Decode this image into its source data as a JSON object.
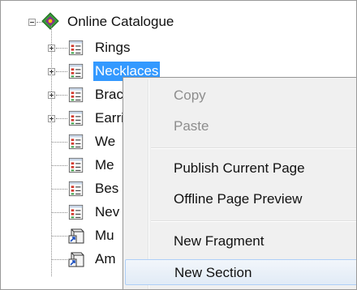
{
  "tree": {
    "root": {
      "label": "Online Catalogue",
      "icon": "catalogue-icon"
    },
    "items": [
      {
        "label": "Rings",
        "icon": "page-icon",
        "expandable": true
      },
      {
        "label": "Necklaces",
        "icon": "page-icon",
        "expandable": true,
        "selected": true
      },
      {
        "label": "Bracelets",
        "icon": "page-icon",
        "expandable": true
      },
      {
        "label": "Earrings",
        "icon": "page-icon",
        "expandable": true
      },
      {
        "label": "We",
        "icon": "page-icon",
        "expandable": false
      },
      {
        "label": "Me",
        "icon": "page-icon",
        "expandable": false
      },
      {
        "label": "Bes",
        "icon": "page-icon",
        "expandable": false
      },
      {
        "label": "Nev",
        "icon": "page-icon",
        "expandable": false
      },
      {
        "label": "Mu",
        "icon": "section-icon",
        "expandable": false
      },
      {
        "label": "Am",
        "icon": "section-icon",
        "expandable": false
      }
    ]
  },
  "context_menu": {
    "items": [
      {
        "label": "Copy",
        "enabled": false
      },
      {
        "label": "Paste",
        "enabled": false
      },
      {
        "label": "Publish Current Page",
        "enabled": true
      },
      {
        "label": "Offline Page Preview",
        "enabled": true
      },
      {
        "label": "New Fragment",
        "enabled": true
      },
      {
        "label": "New Section",
        "enabled": true,
        "hovered": true
      }
    ]
  },
  "colors": {
    "selection": "#3399ff",
    "menu_background": "#f0f0f0",
    "menu_hover_border": "#aecff7",
    "disabled_text": "#8d8d8d"
  }
}
